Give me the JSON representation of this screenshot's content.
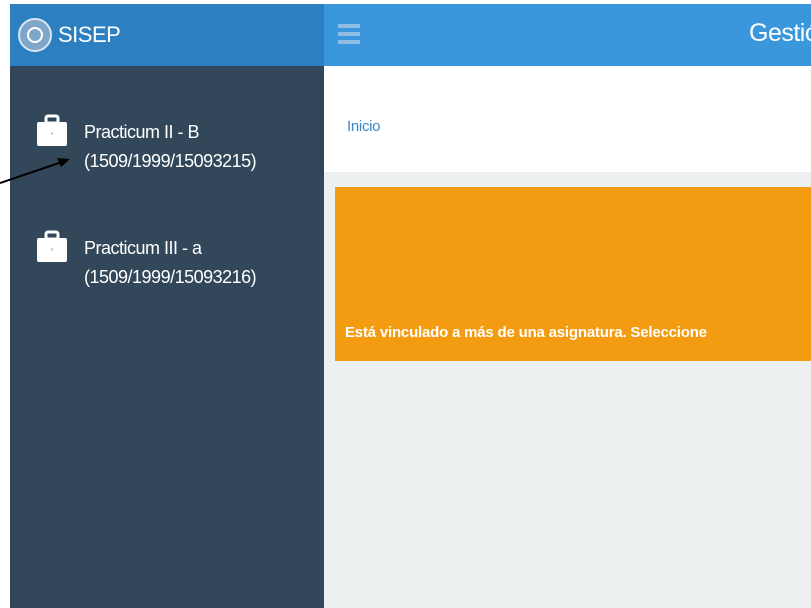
{
  "sidebar": {
    "brand": {
      "name": "SISEP"
    },
    "items": [
      {
        "title": "Practicum II - B",
        "code": "(1509/1999/15093215)"
      },
      {
        "title": "Practicum III - a",
        "code": "(1509/1999/15093216)"
      }
    ]
  },
  "header": {
    "title": "Gestión"
  },
  "breadcrumb": {
    "home": "Inicio"
  },
  "alert": {
    "message": "Está vinculado a más de una asignatura. Seleccione"
  },
  "colors": {
    "sidebar": "#33475b",
    "brand_bar": "#2c7fc0",
    "topbar": "#3a97db",
    "alert": "#f39c12",
    "content_bg": "#ecf0f1",
    "link": "#3a87c9"
  }
}
